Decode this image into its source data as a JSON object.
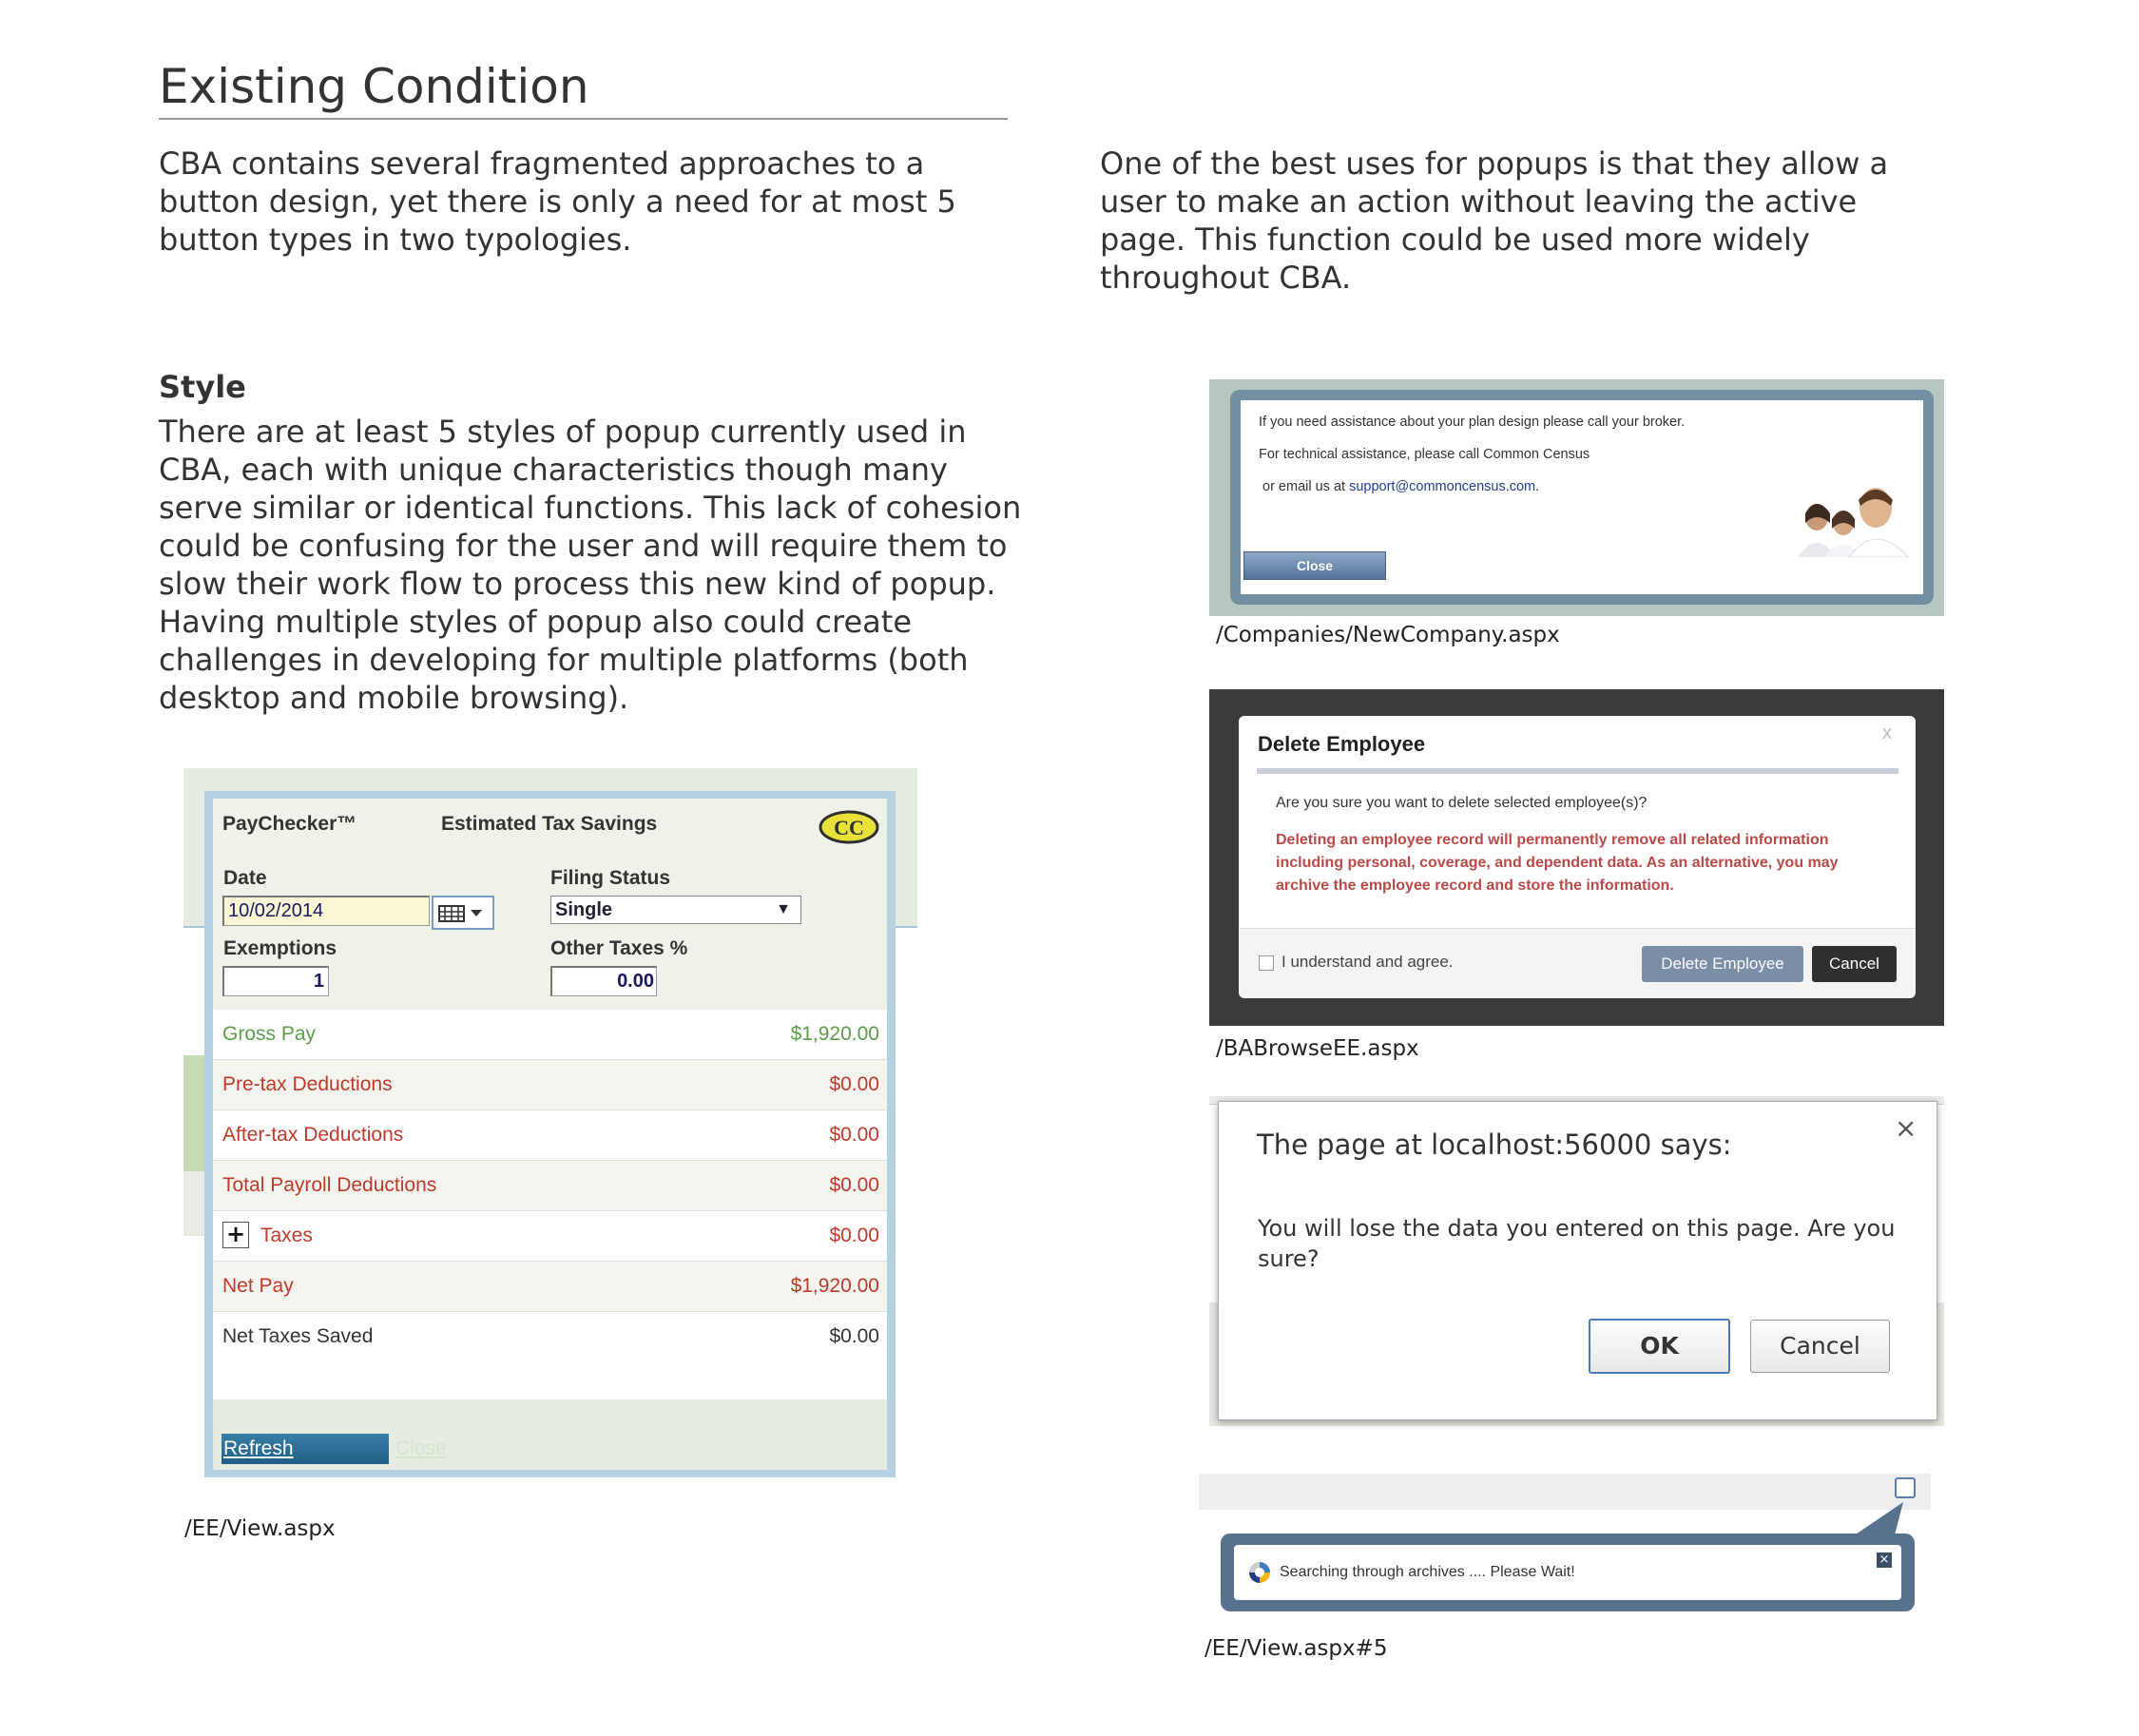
{
  "page": {
    "title": "Existing Condition",
    "intro_left": "CBA contains several fragmented approaches to a button design, yet there is only a need for at most 5 button types in two typologies.",
    "intro_right": "One of the best uses for popups is that they allow a user to make an action without leaving the active page. This function could be used more widely throughout CBA.",
    "style_heading": "Style",
    "style_body": "There are at least 5 styles of popup currently used in CBA, each with unique characteristics though many serve similar or identical functions. This lack of cohesion could be confusing for the user and will require them to slow their work flow to process this new kind of popup. Having multiple styles of popup also could create challenges in developing for multiple platforms (both desktop and mobile browsing)."
  },
  "popup_assistance": {
    "line1": "If you need assistance about your plan design please call your broker.",
    "line2": "For technical assistance, please call Common Census",
    "line3_prefix": "or email us at",
    "email": "support@commoncensus.com",
    "line3_suffix": ".",
    "close_label": "Close",
    "caption": "/Companies/NewCompany.aspx"
  },
  "popup_delete": {
    "title": "Delete Employee",
    "close_x": "x",
    "question": "Are you sure you want to delete selected employee(s)?",
    "warning": "Deleting an employee record will permanently remove all related information including personal, coverage, and dependent data. As an alternative, you may archive the employee record and store the information.",
    "agree_label": "I understand and agree.",
    "delete_label": "Delete Employee",
    "cancel_label": "Cancel",
    "caption": "/BABrowseEE.aspx"
  },
  "popup_confirm": {
    "title": "The page at localhost:56000 says:",
    "close_x": "×",
    "message": "You will lose the data you entered on this page. Are you sure?",
    "ok_label": "OK",
    "cancel_label": "Cancel"
  },
  "popup_searching": {
    "message": "Searching through archives .... Please Wait!",
    "close_x": "×",
    "caption": "/EE/View.aspx#5"
  },
  "paychecker": {
    "app_name": "PayChecker™",
    "subtitle": "Estimated Tax Savings",
    "logo_text": "CC",
    "date_label": "Date",
    "date_value": "10/02/2014",
    "filing_label": "Filing Status",
    "filing_value": "Single",
    "exemptions_label": "Exemptions",
    "exemptions_value": "1",
    "other_taxes_label": "Other Taxes %",
    "other_taxes_value": "0.00",
    "rows": [
      {
        "label": "Gross Pay",
        "value": "$1,920.00",
        "color": "#5a9e4a"
      },
      {
        "label": "Pre-tax Deductions",
        "value": "$0.00",
        "color": "#c0392b"
      },
      {
        "label": "After-tax Deductions",
        "value": "$0.00",
        "color": "#c0392b"
      },
      {
        "label": "Total Payroll Deductions",
        "value": "$0.00",
        "color": "#c0392b"
      },
      {
        "label": "Taxes",
        "value": "$0.00",
        "color": "#c0392b"
      },
      {
        "label": "Net Pay",
        "value": "$1,920.00",
        "color": "#c0392b"
      },
      {
        "label": "Net Taxes Saved",
        "value": "$0.00",
        "color": "#333333"
      }
    ],
    "expand_symbol": "+",
    "refresh_label": "Refresh",
    "close_label": "Close",
    "caption": "/EE/View.aspx"
  }
}
